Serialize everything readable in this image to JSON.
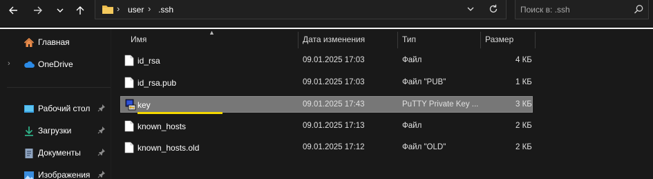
{
  "toolbar": {
    "back_icon": "arrow-left-icon",
    "forward_icon": "arrow-right-icon",
    "recent_icon": "chevron-down-icon",
    "up_icon": "arrow-up-icon"
  },
  "address": {
    "crumbs": [
      "user",
      ".ssh"
    ],
    "separator": "›"
  },
  "search": {
    "placeholder": "Поиск в: .ssh"
  },
  "sidebar": {
    "items": [
      {
        "label": "Главная",
        "icon": "home-icon",
        "pinned": false
      },
      {
        "label": "OneDrive",
        "icon": "cloud-icon",
        "pinned": false,
        "expandable": true
      },
      {
        "label": "Рабочий стол",
        "icon": "desktop-icon",
        "pinned": true
      },
      {
        "label": "Загрузки",
        "icon": "download-icon",
        "pinned": true
      },
      {
        "label": "Документы",
        "icon": "document-icon",
        "pinned": true
      },
      {
        "label": "Изображения",
        "icon": "image-icon",
        "pinned": true
      }
    ]
  },
  "columns": {
    "name": "Имя",
    "date": "Дата изменения",
    "type": "Тип",
    "size": "Размер"
  },
  "files": [
    {
      "name": "id_rsa",
      "date": "09.01.2025 17:03",
      "type": "Файл",
      "size": "4 КБ",
      "icon": "file-icon"
    },
    {
      "name": "id_rsa.pub",
      "date": "09.01.2025 17:03",
      "type": "Файл \"PUB\"",
      "size": "1 КБ",
      "icon": "file-icon"
    },
    {
      "name": "key",
      "date": "09.01.2025 17:43",
      "type": "PuTTY Private Key ...",
      "size": "3 КБ",
      "icon": "putty-key-icon",
      "selected": true
    },
    {
      "name": "known_hosts",
      "date": "09.01.2025 17:13",
      "type": "Файл",
      "size": "2 КБ",
      "icon": "file-icon"
    },
    {
      "name": "known_hosts.old",
      "date": "09.01.2025 17:12",
      "type": "Файл \"OLD\"",
      "size": "2 КБ",
      "icon": "file-icon"
    }
  ],
  "colors": {
    "background": "#191919",
    "selection": "#777777",
    "folder": "#e8b84a",
    "highlight_underline": "#f5d800"
  }
}
